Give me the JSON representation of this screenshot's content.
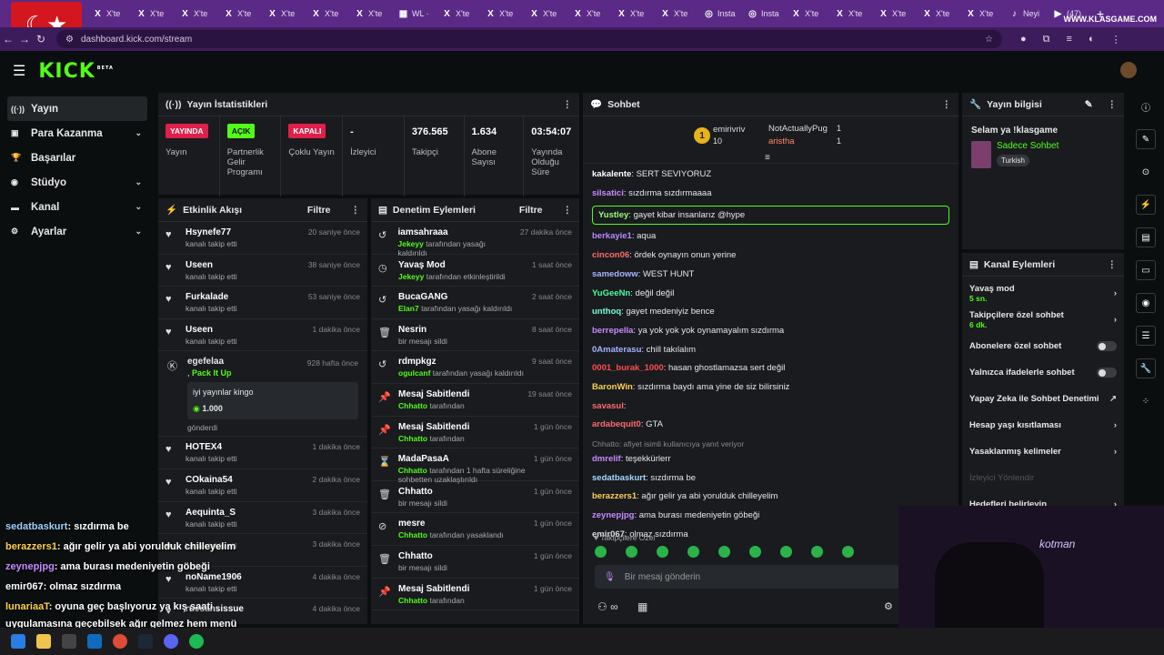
{
  "browser": {
    "tabs": [
      {
        "icon": "x-icon",
        "label": "X'te"
      },
      {
        "icon": "x-icon",
        "label": "X'te"
      },
      {
        "icon": "x-icon",
        "label": "X'te"
      },
      {
        "icon": "x-icon",
        "label": "X'te"
      },
      {
        "icon": "x-icon",
        "label": "X'te"
      },
      {
        "icon": "x-icon",
        "label": "X'te"
      },
      {
        "icon": "x-icon",
        "label": "X'te"
      },
      {
        "icon": "sheets-icon",
        "label": "WL ·"
      },
      {
        "icon": "x-icon",
        "label": "X'te"
      },
      {
        "icon": "x-icon",
        "label": "X'te"
      },
      {
        "icon": "x-icon",
        "label": "X'te"
      },
      {
        "icon": "x-icon",
        "label": "X'te"
      },
      {
        "icon": "x-icon",
        "label": "X'te"
      },
      {
        "icon": "x-icon",
        "label": "X'te"
      },
      {
        "icon": "instagram-icon",
        "label": "Insta"
      },
      {
        "icon": "instagram-icon",
        "label": "Insta"
      },
      {
        "icon": "x-icon",
        "label": "X'te"
      },
      {
        "icon": "x-icon",
        "label": "X'te"
      },
      {
        "icon": "x-icon",
        "label": "X'te"
      },
      {
        "icon": "x-icon",
        "label": "X'te"
      },
      {
        "icon": "x-icon",
        "label": "X'te"
      },
      {
        "icon": "tiktok-icon",
        "label": "Neyi"
      },
      {
        "icon": "youtube-icon",
        "label": "(47)"
      }
    ],
    "watermark": "WWW.KLASGAME.COM",
    "url": "dashboard.kick.com/stream"
  },
  "kick": {
    "logo": "KICK",
    "beta": "BETA"
  },
  "sidebar": [
    {
      "label": "Yayın",
      "icon": "broadcast-icon",
      "chev": false,
      "active": true
    },
    {
      "label": "Para Kazanma",
      "icon": "money-icon",
      "chev": true,
      "active": false
    },
    {
      "label": "Başarılar",
      "icon": "trophy-icon",
      "chev": false,
      "active": false
    },
    {
      "label": "Stüdyo",
      "icon": "studio-icon",
      "chev": true,
      "active": false
    },
    {
      "label": "Kanal",
      "icon": "channel-icon",
      "chev": true,
      "active": false
    },
    {
      "label": "Ayarlar",
      "icon": "settings-icon",
      "chev": true,
      "active": false
    }
  ],
  "stats_panel": {
    "title": "Yayın İstatistikleri",
    "items": [
      {
        "pill": "YAYINDA",
        "pill_color": "#e0204a",
        "label": "Yayın"
      },
      {
        "pill": "AÇIK",
        "pill_color": "#53fc18",
        "label": "Partnerlik Gelir Programı"
      },
      {
        "pill": "KAPALI",
        "pill_color": "#e0204a",
        "label": "Çoklu Yayın"
      },
      {
        "value": "-",
        "label": "İzleyici"
      },
      {
        "value": "376.565",
        "label": "Takipçi"
      },
      {
        "value": "1.634",
        "label": "Abone Sayısı"
      },
      {
        "value": "03:54:07",
        "label": "Yayında Olduğu Süre"
      }
    ]
  },
  "activity": {
    "title": "Etkinlik Akışı",
    "filter": "Filtre",
    "rows": [
      {
        "name": "Hsynefe77",
        "sub": "kanalı takip etti",
        "time": "20 saniye önce"
      },
      {
        "name": "Useen",
        "sub": "kanalı takip etti",
        "time": "38 saniye önce"
      },
      {
        "name": "Furkalade",
        "sub": "kanalı takip etti",
        "time": "53 saniye önce"
      },
      {
        "name": "Useen",
        "sub": "kanalı takip etti",
        "time": "1 dakika önce"
      }
    ],
    "gift": {
      "name": "egefelaa",
      "action": "Pack It Up",
      "time": "928 hafta önce",
      "message": "iyi yayınlar kingo",
      "amount": "1.000",
      "sent": "gönderdi"
    },
    "rows2": [
      {
        "name": "HOTEX4",
        "sub": "kanalı takip etti",
        "time": "1 dakika önce"
      },
      {
        "name": "COkaina54",
        "sub": "kanalı takip etti",
        "time": "2 dakika önce"
      },
      {
        "name": "Aequinta_S",
        "sub": "kanalı takip etti",
        "time": "3 dakika önce"
      },
      {
        "name": "",
        "sub": "kanalı takip etti",
        "time": "3 dakika önce"
      },
      {
        "name": "noName1906",
        "sub": "kanalı takip etti",
        "time": "4 dakika önce"
      },
      {
        "name": "ruesansissue",
        "sub": "",
        "time": "4 dakika önce"
      }
    ]
  },
  "moderation": {
    "title": "Denetim Eylemleri",
    "filter": "Filtre",
    "rows": [
      {
        "icon": "undo-icon",
        "name": "iamsahraaa",
        "mod": "Jekeyy",
        "sub": "tarafından yasağı kaldırıldı",
        "time": "27 dakika önce"
      },
      {
        "icon": "slow-icon",
        "name": "Yavaş Mod",
        "mod": "Jekeyy",
        "sub": "tarafından etkinleştirildi",
        "time": "1 saat önce"
      },
      {
        "icon": "undo-icon",
        "name": "BucaGANG",
        "mod": "Elan7",
        "sub": "tarafından yasağı kaldırıldı",
        "time": "2 saat önce"
      },
      {
        "icon": "trash-icon",
        "name": "Nesrin",
        "mod": "",
        "sub": "bir mesajı sildi",
        "time": "8 saat önce"
      },
      {
        "icon": "undo-icon",
        "name": "rdmpkgz",
        "mod": "ogulcanf",
        "sub": "tarafından yasağı kaldırıldı",
        "time": "9 saat önce"
      },
      {
        "icon": "pin-icon",
        "name": "Mesaj Sabitlendi",
        "mod": "Chhatto",
        "sub": "tarafından",
        "time": "19 saat önce"
      },
      {
        "icon": "pin-icon",
        "name": "Mesaj Sabitlendi",
        "mod": "Chhatto",
        "sub": "tarafından",
        "time": "1 gün önce"
      },
      {
        "icon": "hourglass-icon",
        "name": "MadaPasaA",
        "mod": "Chhatto",
        "sub": "tarafından 1 hafta süreliğine sohbetten uzaklaştırıldı",
        "time": "1 gün önce"
      },
      {
        "icon": "trash-icon",
        "name": "Chhatto",
        "mod": "",
        "sub": "bir mesajı sildi",
        "time": "1 gün önce"
      },
      {
        "icon": "ban-icon",
        "name": "mesre",
        "mod": "Chhatto",
        "sub": "tarafından yasaklandı",
        "time": "1 gün önce"
      },
      {
        "icon": "trash-icon",
        "name": "Chhatto",
        "mod": "",
        "sub": "bir mesajı sildi",
        "time": "1 gün önce"
      },
      {
        "icon": "pin-icon",
        "name": "Mesaj Sabitlendi",
        "mod": "Chhatto",
        "sub": "tarafından",
        "time": "1 gün önce"
      }
    ]
  },
  "chat": {
    "title": "Sohbet",
    "leader": {
      "rank": "1",
      "name": "emirivriv",
      "count": "10",
      "second": "NotActuallyPug",
      "second_count": "1",
      "third": "aristha",
      "third_count": "1"
    },
    "messages": [
      {
        "user": "kakalente",
        "color": "#ffffff",
        "text": "SERT SEVIYORUZ"
      },
      {
        "user": "silsatici",
        "color": "#c98bff",
        "text": "sızdırma sızdırmaaaa"
      },
      {
        "user": "Yustley",
        "color": "#9dff7a",
        "text": "gayet kibar insanlarız @hype",
        "highlight": true
      },
      {
        "user": "berkayie1",
        "color": "#b88bff",
        "text": "aqua"
      },
      {
        "user": "cincon06",
        "color": "#ff6b6b",
        "text": "ördek oynayın onun yerine"
      },
      {
        "user": "samedoww",
        "color": "#a8b4ff",
        "text": "WEST HUNT"
      },
      {
        "user": "YuGeeNn",
        "color": "#4cff9f",
        "text": "değil değil"
      },
      {
        "user": "unthoq",
        "color": "#7affd8",
        "text": "gayet medeniyiz bence"
      },
      {
        "user": "berrepella",
        "color": "#c98bff",
        "text": "ya yok yok yok oynamayalım sızdırma"
      },
      {
        "user": "0Amaterasu",
        "color": "#a8b4ff",
        "text": "chill takılalım"
      },
      {
        "user": "0001_burak_1000",
        "color": "#ff4d4d",
        "text": "hasan ghostlamazsa sert değil"
      },
      {
        "user": "BaronWin",
        "color": "#ffd24d",
        "text": "sızdırma baydı ama yine de siz bilirsiniz"
      },
      {
        "user": "savasul",
        "color": "#ff6b6b",
        "text": ""
      },
      {
        "user": "ardabequit0",
        "color": "#ff6b6b",
        "text": "GTA"
      },
      {
        "user": "dmrelif",
        "color": "#c98bff",
        "text": "teşekkürlerr",
        "reply": "Chhatto: afiyet isimli kullanıcıya yanıt veriyor"
      },
      {
        "user": "sedatbaskurt",
        "color": "#a8d8ff",
        "text": "sızdırma be"
      },
      {
        "user": "berazzers1",
        "color": "#ffd24d",
        "text": "ağır gelir ya abi yorulduk chilleyelim"
      },
      {
        "user": "zeynepjpg",
        "color": "#c98bff",
        "text": "ama burası medeniyetin göbeği"
      },
      {
        "user": "emir067",
        "color": "#dddddd",
        "text": "olmaz sızdırma"
      }
    ],
    "followers_only": "Takipçilere Özel",
    "placeholder": "Bir mesaj gönderin"
  },
  "stream_info": {
    "title": "Yayın bilgisi",
    "stream_title": "Selam ya !klasgame",
    "category": "Sadece Sohbet",
    "tag": "Turkish"
  },
  "channel_actions": {
    "title": "Kanal Eylemleri",
    "items": [
      {
        "label": "Yavaş mod",
        "sub": "5 sn.",
        "type": "chev"
      },
      {
        "label": "Takipçilere özel sohbet",
        "sub": "6 dk.",
        "type": "chev"
      },
      {
        "label": "Abonelere özel sohbet",
        "sub": "",
        "type": "toggle"
      },
      {
        "label": "Yalnızca ifadelerle sohbet",
        "sub": "",
        "type": "toggle"
      },
      {
        "label": "Yapay Zeka ile Sohbet Denetimi",
        "sub": "",
        "type": "ext"
      },
      {
        "label": "Hesap yaşı kısıtlaması",
        "sub": "",
        "type": "chev"
      },
      {
        "label": "Yasaklanmış kelimeler",
        "sub": "",
        "type": "chev"
      },
      {
        "label": "İzleyici Yönlendir",
        "sub": "",
        "type": "dim"
      },
      {
        "label": "Hedefleri belirleyin",
        "sub": "",
        "type": "chev"
      }
    ]
  },
  "overlay_chat": [
    {
      "user": "sedatbaskurt",
      "color": "#9fd0ff",
      "text": ": sızdırma be"
    },
    {
      "user": "berazzers1",
      "color": "#ffd24d",
      "text": ": ağır gelir ya abi yorulduk chilleyelim"
    },
    {
      "user": "zeynepjpg",
      "color": "#c98bff",
      "text": ": ama burası medeniyetin göbeği"
    },
    {
      "user": "emir067",
      "color": "#ffffff",
      "text": ": olmaz sızdırma"
    },
    {
      "user": "lunariaaT",
      "color": "#ffd24d",
      "text": ": oyuna geç başlıyoruz ya kış saati"
    },
    {
      "user": "",
      "color": "#ffffff",
      "text": "uygulamasına geçebilsek ağır gelmez hem menü"
    }
  ],
  "cam_text": "kotman",
  "colors": {
    "accent": "#53fc18",
    "panel": "#191b1f",
    "bg": "#0b0e0f",
    "tab_bar": "#5b2a86"
  }
}
